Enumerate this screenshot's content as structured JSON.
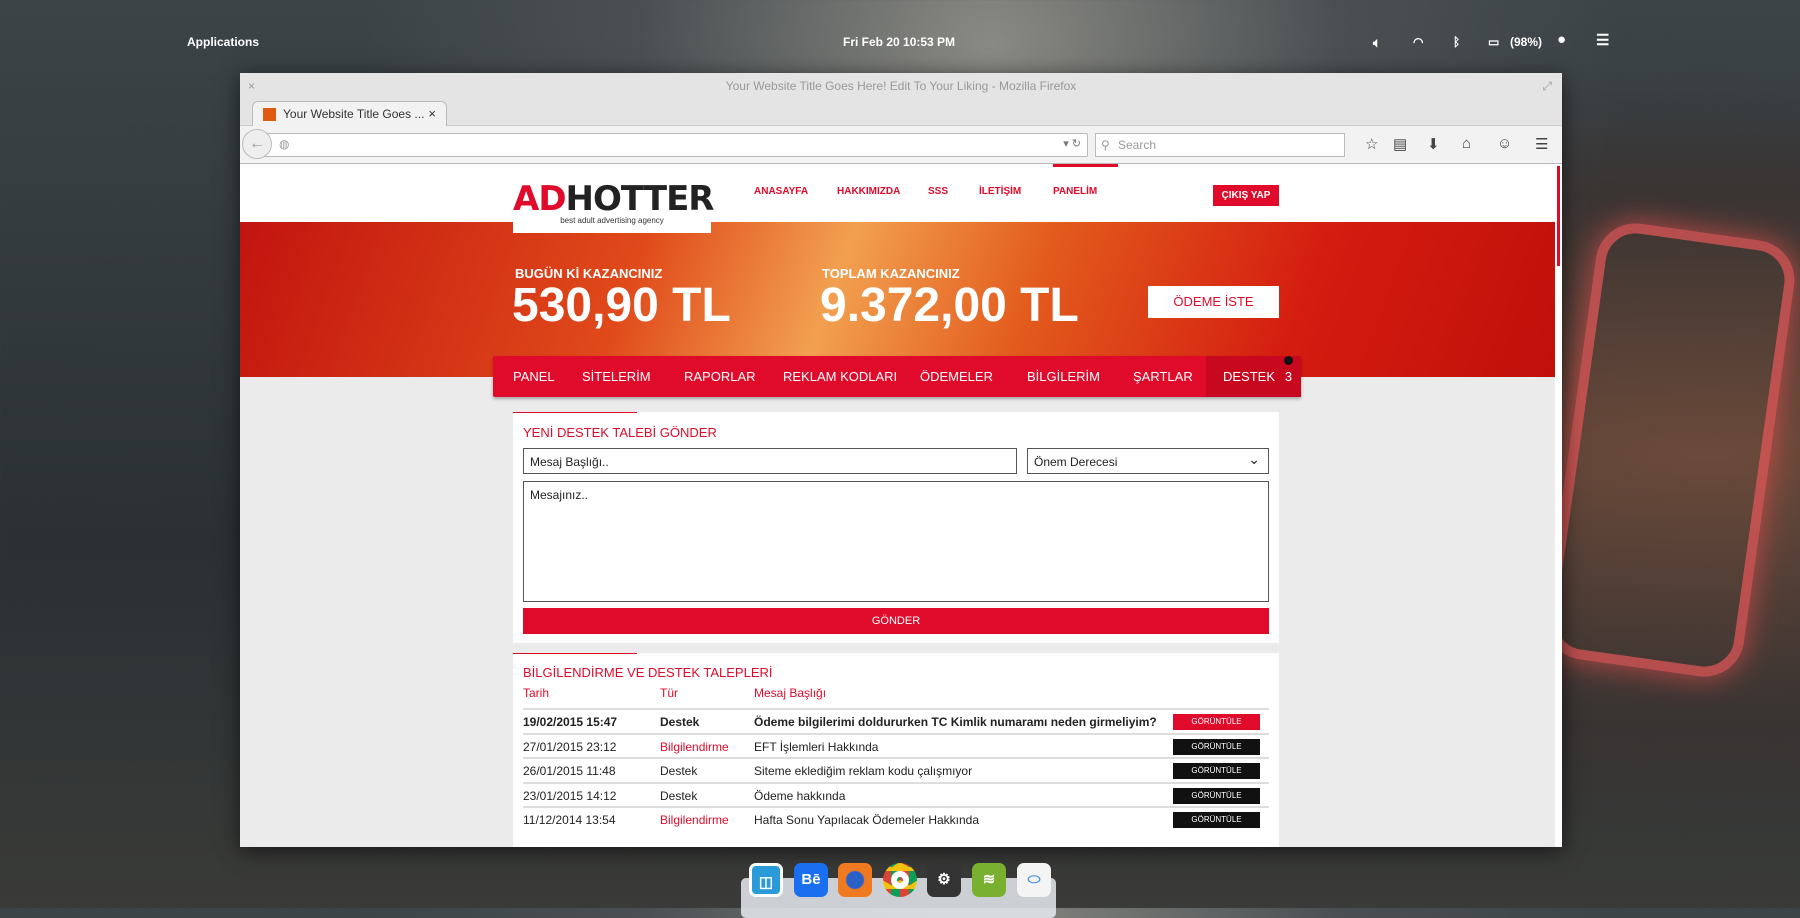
{
  "desktop": {
    "applications": "Applications",
    "clock": "Fri Feb 20   10:53  PM",
    "battery": "(98%)"
  },
  "window": {
    "title": "Your Website Title Goes Here! Edit To Your Liking - Mozilla Firefox",
    "tab_title": "Your Website Title Goes  ...",
    "search_placeholder": "Search"
  },
  "site": {
    "logo_ad": "AD",
    "logo_hotter": "HOTTER",
    "logo_tagline": "best adult advertising agency",
    "nav": [
      "ANASAYFA",
      "HAKKIMIZDA",
      "SSS",
      "İLETİŞİM",
      "PANELİM"
    ],
    "logout": "ÇIKIŞ YAP",
    "today_label": "BUGÜN Kİ KAZANCINIZ",
    "today_amount": "530,90 TL",
    "total_label": "TOPLAM KAZANCINIZ",
    "total_amount": "9.372,00 TL",
    "payout_button": "ÖDEME İSTE",
    "menu": [
      "PANEL",
      "SİTELERİM",
      "RAPORLAR",
      "REKLAM KODLARI",
      "ÖDEMELER",
      "BİLGİLERİM",
      "ŞARTLAR",
      "DESTEK"
    ],
    "support_badge": "3"
  },
  "form": {
    "title": "YENİ DESTEK TALEBİ GÖNDER",
    "subject_placeholder": "Mesaj Başlığı..",
    "priority": "Önem Derecesi",
    "message_placeholder": "Mesajınız..",
    "submit": "GÖNDER"
  },
  "tickets": {
    "title": "BİLGİLENDİRME VE DESTEK TALEPLERİ",
    "headers": [
      "Tarih",
      "Tür",
      "Mesaj Başlığı"
    ],
    "rows": [
      {
        "date": "19/02/2015 15:47",
        "type": "Destek",
        "subject": "Ödeme bilgilerimi doldururken TC Kimlik numaramı neden girmeliyim?",
        "action": "GÖRÜNTÜLE"
      },
      {
        "date": "27/01/2015 23:12",
        "type": "Bilgilendirme",
        "subject": "EFT İşlemleri Hakkında",
        "action": "GÖRÜNTÜLE"
      },
      {
        "date": "26/01/2015 11:48",
        "type": "Destek",
        "subject": "Siteme eklediğim reklam kodu çalışmıyor",
        "action": "GÖRÜNTÜLE"
      },
      {
        "date": "23/01/2015 14:12",
        "type": "Destek",
        "subject": "Ödeme hakkında",
        "action": "GÖRÜNTÜLE"
      },
      {
        "date": "11/12/2014 13:54",
        "type": "Bilgilendirme",
        "subject": "Hafta Sonu Yapılacak Ödemeler Hakkında",
        "action": "GÖRÜNTÜLE"
      }
    ]
  },
  "dock": {
    "apps": [
      "workspace-icon",
      "behance-icon",
      "firefox-icon",
      "chrome-icon",
      "steam-icon",
      "spotify-icon",
      "switchboard-icon"
    ],
    "behance_label": "Bē"
  },
  "colors": {
    "accent": "#e00b2b"
  }
}
